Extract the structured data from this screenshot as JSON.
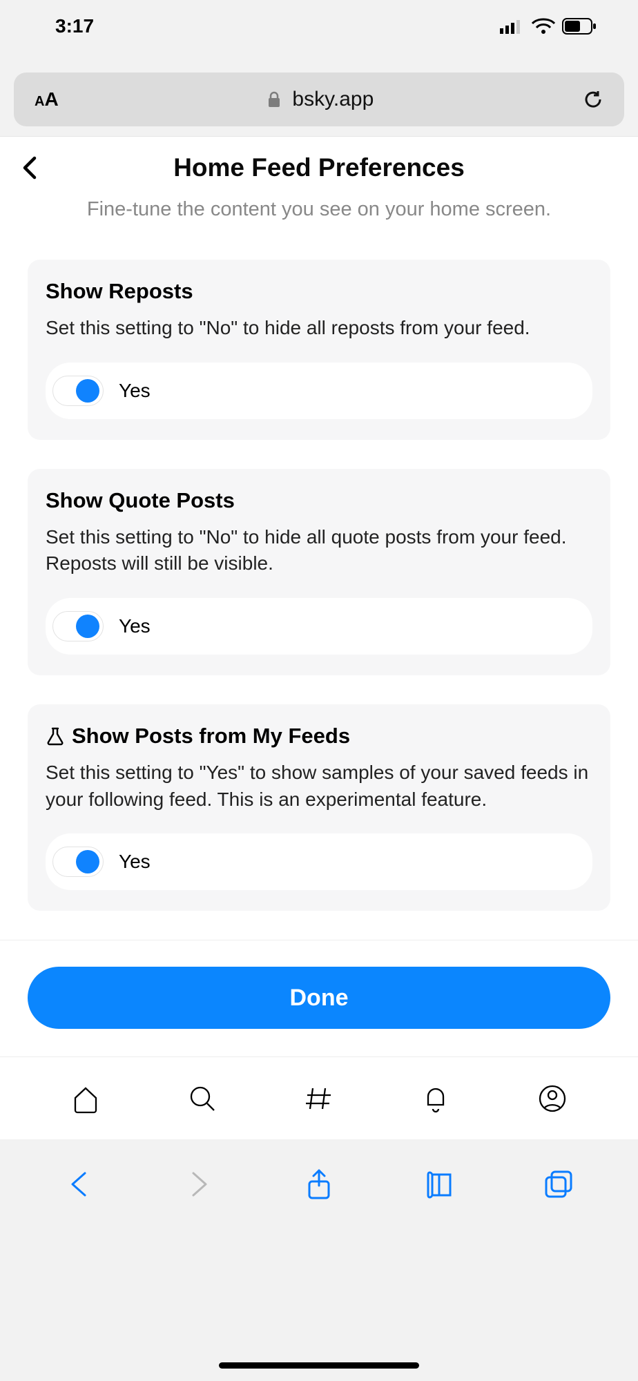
{
  "status": {
    "time": "3:17"
  },
  "browser": {
    "domain": "bsky.app"
  },
  "page": {
    "title": "Home Feed Preferences",
    "subtitle": "Fine-tune the content you see on your home screen."
  },
  "settings": [
    {
      "title": "Show Reposts",
      "desc": "Set this setting to \"No\" to hide all reposts from your feed.",
      "value_label": "Yes",
      "icon": null
    },
    {
      "title": "Show Quote Posts",
      "desc": "Set this setting to \"No\" to hide all quote posts from your feed. Reposts will still be visible.",
      "value_label": "Yes",
      "icon": null
    },
    {
      "title": "Show Posts from My Feeds",
      "desc": "Set this setting to \"Yes\" to show samples of your saved feeds in your following feed. This is an experimental feature.",
      "value_label": "Yes",
      "icon": "beaker"
    }
  ],
  "done_label": "Done"
}
